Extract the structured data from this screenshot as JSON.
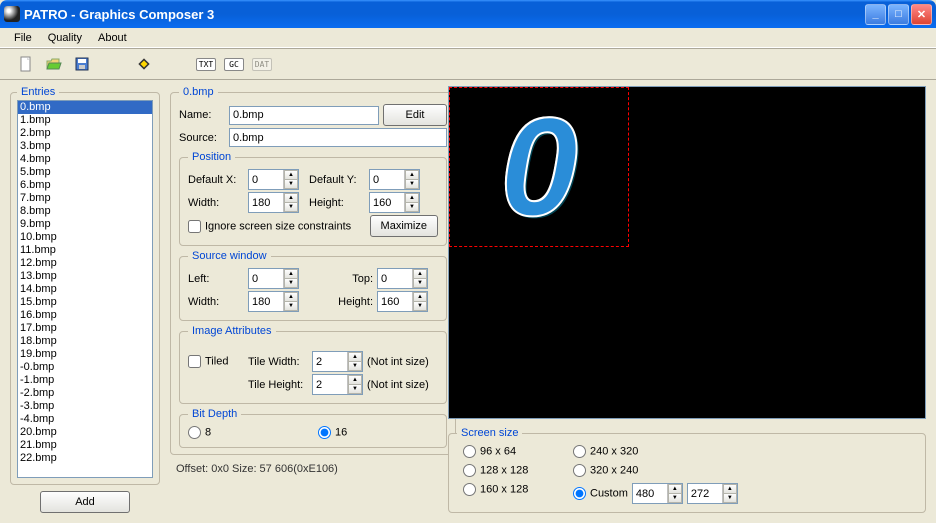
{
  "window": {
    "title": "PATRO - Graphics Composer 3"
  },
  "menu": {
    "file": "File",
    "quality": "Quality",
    "about": "About"
  },
  "toolbar": {
    "txt": "TXT",
    "gc": "GC",
    "dat": "DAT"
  },
  "entries": {
    "legend": "Entries",
    "add": "Add",
    "items": [
      "0.bmp",
      "1.bmp",
      "2.bmp",
      "3.bmp",
      "4.bmp",
      "5.bmp",
      "6.bmp",
      "7.bmp",
      "8.bmp",
      "9.bmp",
      "10.bmp",
      "11.bmp",
      "12.bmp",
      "13.bmp",
      "14.bmp",
      "15.bmp",
      "16.bmp",
      "17.bmp",
      "18.bmp",
      "19.bmp",
      "-0.bmp",
      "-1.bmp",
      "-2.bmp",
      "-3.bmp",
      "-4.bmp",
      "20.bmp",
      "21.bmp",
      "22.bmp"
    ],
    "selected": 0
  },
  "props": {
    "legend": "0.bmp",
    "name_label": "Name:",
    "name_value": "0.bmp",
    "source_label": "Source:",
    "source_value": "0.bmp",
    "edit": "Edit"
  },
  "position": {
    "legend": "Position",
    "defx_label": "Default X:",
    "defx": "0",
    "defy_label": "Default Y:",
    "defy": "0",
    "width_label": "Width:",
    "width": "180",
    "height_label": "Height:",
    "height": "160",
    "ignore_label": "Ignore screen size constraints",
    "maximize": "Maximize"
  },
  "sourcewin": {
    "legend": "Source window",
    "left_label": "Left:",
    "left": "0",
    "top_label": "Top:",
    "top": "0",
    "width_label": "Width:",
    "width": "180",
    "height_label": "Height:",
    "height": "160"
  },
  "imgattr": {
    "legend": "Image Attributes",
    "tiled_label": "Tiled",
    "tilew_label": "Tile Width:",
    "tilew": "2",
    "tileh_label": "Tile Height:",
    "tileh": "2",
    "notint": "(Not int size)"
  },
  "bitdepth": {
    "legend": "Bit Depth",
    "opt8": "8",
    "opt16": "16",
    "selected": "16"
  },
  "offset_line": "Offset: 0x0  Size: 57 606(0xE106)",
  "screensize": {
    "legend": "Screen size",
    "o1": "96 x 64",
    "o2": "240 x 320",
    "o3": "128 x 128",
    "o4": "320 x 240",
    "o5": "160 x 128",
    "o6": "Custom",
    "custom_w": "480",
    "custom_h": "272",
    "selected": "Custom"
  }
}
